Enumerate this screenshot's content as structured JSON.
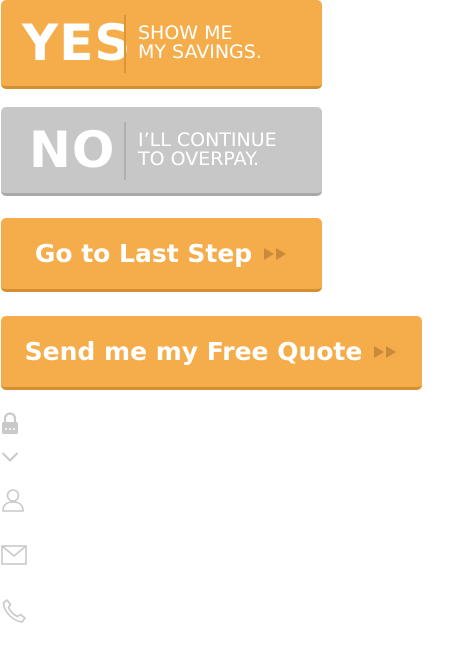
{
  "buttons": {
    "yes": {
      "big": "YES",
      "line1": "SHOW ME",
      "line2": "MY SAVINGS."
    },
    "no": {
      "big": "NO",
      "line1": "I’LL CONTINUE",
      "line2": "TO OVERPAY."
    },
    "last_step": {
      "label": "Go to Last Step"
    },
    "free_quote": {
      "label": "Send me my Free Quote"
    }
  },
  "icons": [
    "lock-icon",
    "chevron-down-icon",
    "user-icon",
    "mail-icon",
    "phone-icon"
  ],
  "colors": {
    "orange": "#f5ad4b",
    "orange_shadow": "#d48f30",
    "gray": "#c7c7c7",
    "arrow": "#c98a3a",
    "icon": "#c9c9c9"
  }
}
